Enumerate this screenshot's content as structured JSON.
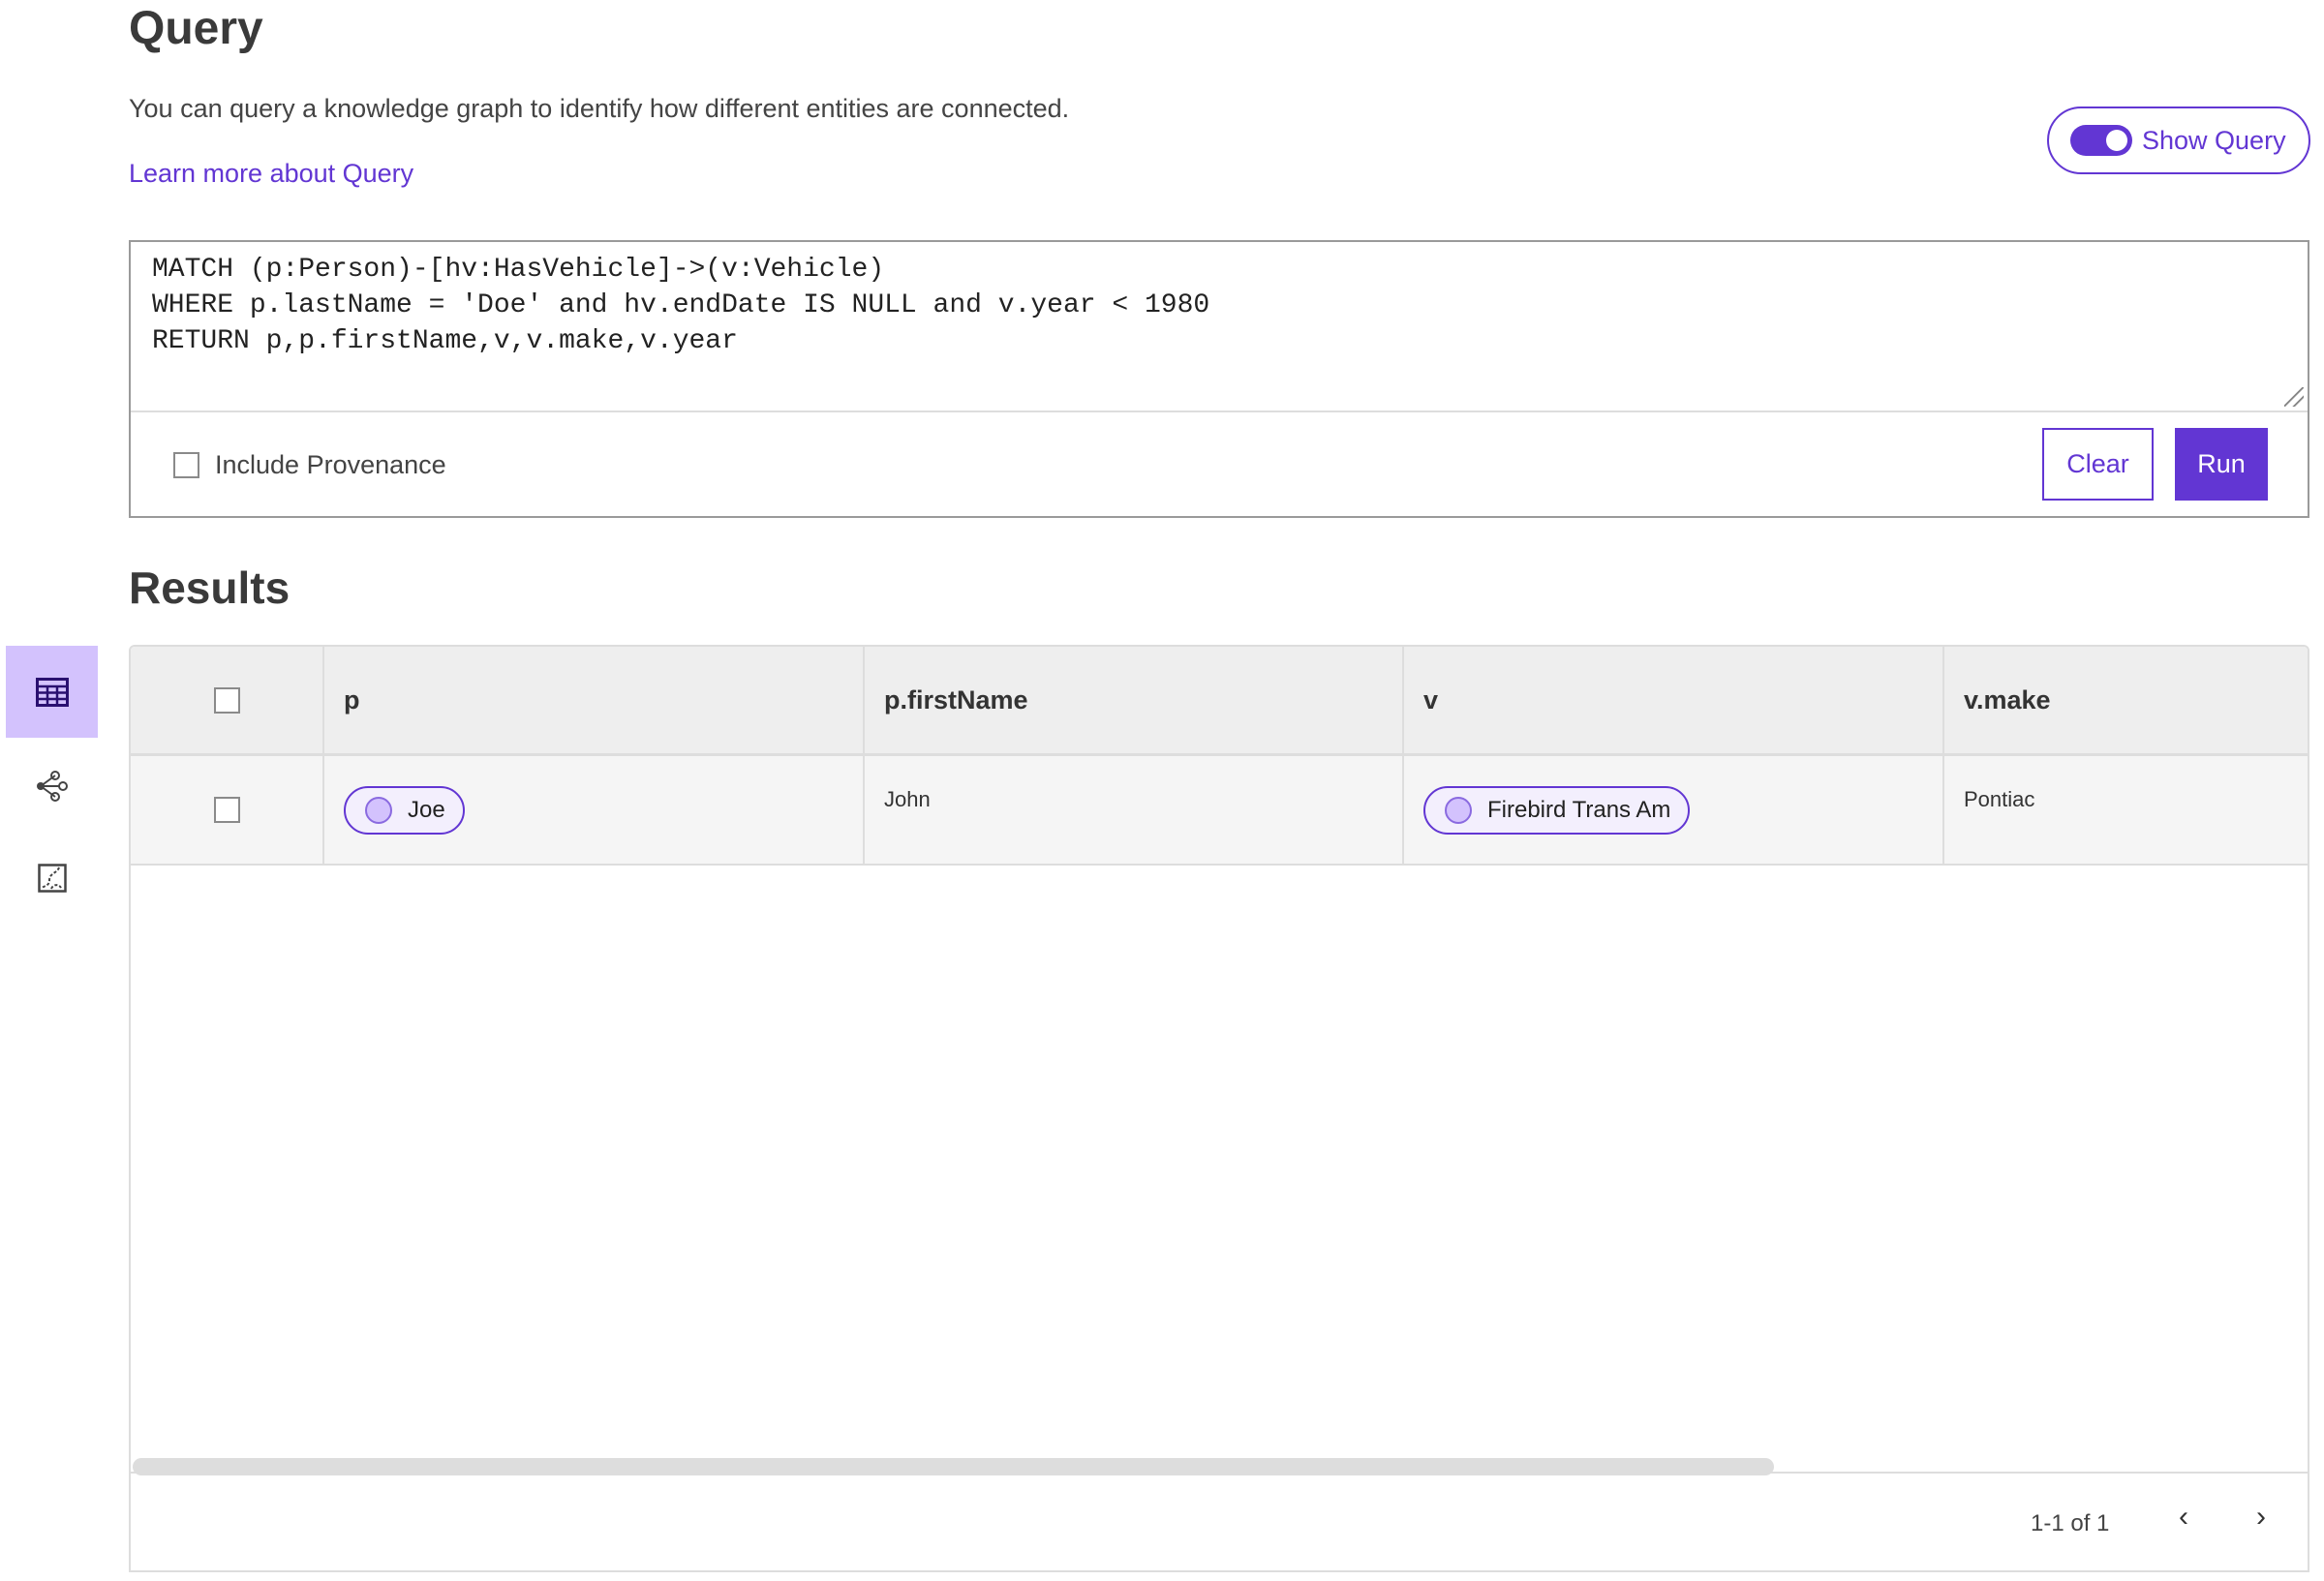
{
  "header": {
    "title": "Query",
    "description": "You can query a knowledge graph to identify how different entities are connected.",
    "learn_more": "Learn more about Query",
    "show_query_label": "Show Query",
    "show_query_on": true
  },
  "query": {
    "text": "MATCH (p:Person)-[hv:HasVehicle]->(v:Vehicle)\nWHERE p.lastName = 'Doe' and hv.endDate IS NULL and v.year < 1980\nRETURN p,p.firstName,v,v.make,v.year",
    "include_provenance_label": "Include Provenance",
    "include_provenance": false,
    "clear_label": "Clear",
    "run_label": "Run"
  },
  "results": {
    "title": "Results",
    "columns": [
      "p",
      "p.firstName",
      "v",
      "v.make"
    ],
    "rows": [
      {
        "p": "Joe",
        "p_firstName": "John",
        "v": "Firebird Trans Am",
        "v_make": "Pontiac"
      }
    ],
    "pagination": "1-1 of 1"
  },
  "sidebar": {
    "items": [
      {
        "icon": "table-icon",
        "active": true
      },
      {
        "icon": "graph-icon",
        "active": false
      },
      {
        "icon": "chart-icon",
        "active": false
      }
    ]
  },
  "colors": {
    "accent": "#6236d3",
    "active_tile": "#d3c2fd"
  }
}
